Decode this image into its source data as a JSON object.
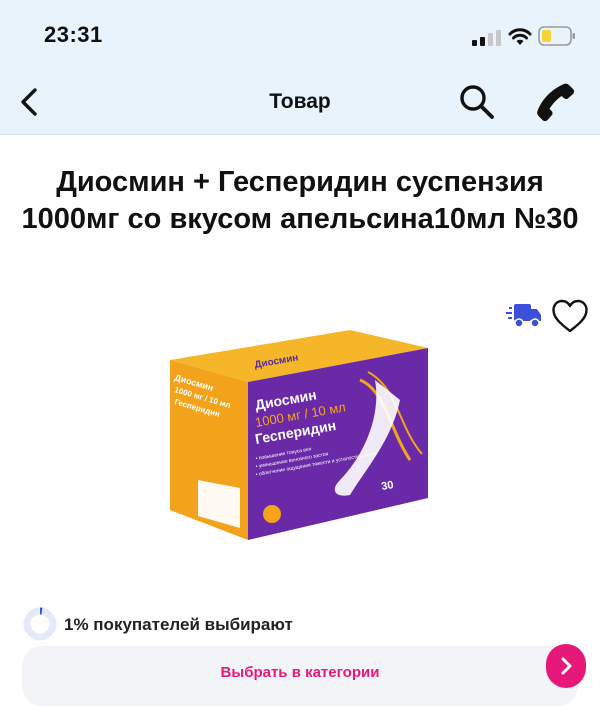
{
  "status_bar": {
    "time": "23:31",
    "signal_icon": "cellular-signal-icon",
    "wifi_icon": "wifi-icon",
    "battery_icon": "battery-low-icon",
    "battery_color": "#f5d33a"
  },
  "nav": {
    "title": "Товар",
    "back_icon": "chevron-left-icon",
    "search_icon": "search-icon",
    "call_icon": "phone-icon"
  },
  "product": {
    "title": "Диосмин + Гесперидин суспензия 1000мг со вкусом апельсина10мл №30",
    "delivery_icon": "delivery-truck-icon",
    "favorite_icon": "heart-outline-icon",
    "image": {
      "brand_line1": "Диосмин",
      "brand_line2": "1000 мг / 10 мл",
      "brand_line3": "Гесперидин",
      "bullets": [
        "• повышение тонуса вен",
        "• уменьшение венозного застоя",
        "• облегчение ощущения тяжести и усталости в ногах"
      ],
      "count": "30"
    }
  },
  "popularity": {
    "percent": 1,
    "text": "1% покупателей выбирают"
  },
  "category_button": {
    "label": "Выбрать в категории",
    "arrow_icon": "chevron-right-icon"
  },
  "colors": {
    "accent": "#e6197a",
    "header_bg": "#e8f3fc",
    "delivery_blue": "#3b4fd8",
    "box_purple": "#6a2aa8",
    "box_orange": "#f4a41a"
  }
}
